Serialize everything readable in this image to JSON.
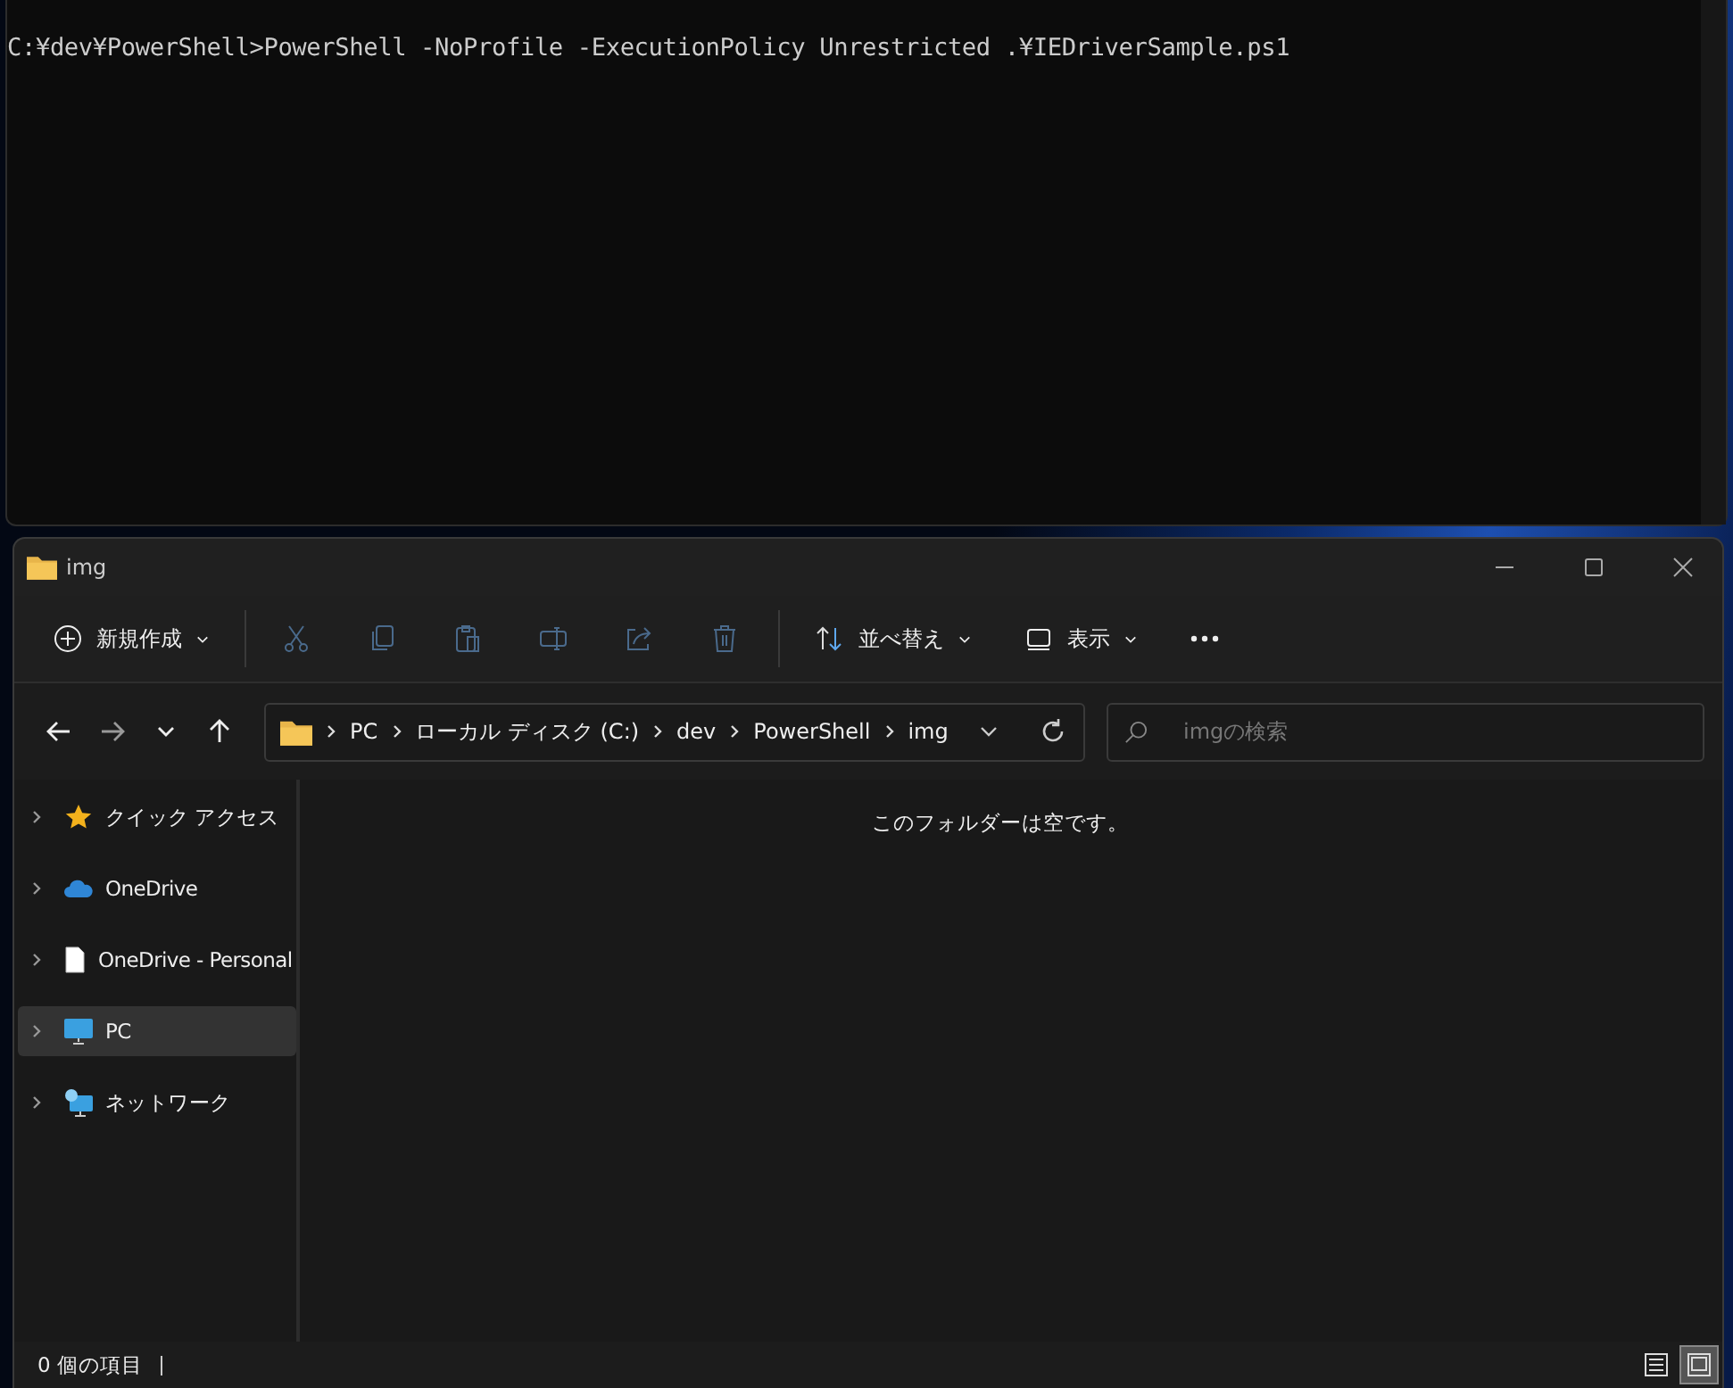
{
  "console": {
    "line": "C:¥dev¥PowerShell>PowerShell -NoProfile -ExecutionPolicy Unrestricted .¥IEDriverSample.ps1"
  },
  "explorer": {
    "title": "img",
    "toolbar": [
      {
        "kind": "new",
        "label": "新規作成",
        "disabled": false
      },
      {
        "kind": "cut",
        "disabled": true
      },
      {
        "kind": "copy",
        "disabled": true
      },
      {
        "kind": "paste",
        "disabled": true
      },
      {
        "kind": "rename",
        "disabled": true
      },
      {
        "kind": "share",
        "disabled": true
      },
      {
        "kind": "delete",
        "disabled": true
      },
      {
        "kind": "sort",
        "label": "並べ替え",
        "disabled": false
      },
      {
        "kind": "view",
        "label": "表示",
        "disabled": false
      },
      {
        "kind": "more",
        "disabled": false
      }
    ],
    "nav": [
      {
        "kind": "back",
        "disabled": false
      },
      {
        "kind": "forward",
        "disabled": true
      },
      {
        "kind": "recent",
        "disabled": false
      },
      {
        "kind": "up",
        "disabled": false
      }
    ],
    "breadcrumb": [
      "PC",
      "ローカル ディスク (C:)",
      "dev",
      "PowerShell",
      "img"
    ],
    "search": {
      "placeholder": "imgの検索"
    },
    "sidebar": [
      {
        "kind": "star",
        "label": "クイック アクセス",
        "selected": false
      },
      {
        "kind": "cloud",
        "label": "OneDrive",
        "selected": false
      },
      {
        "kind": "file",
        "label": "OneDrive - Personal",
        "selected": false
      },
      {
        "kind": "pc",
        "label": "PC",
        "selected": true
      },
      {
        "kind": "network",
        "label": "ネットワーク",
        "selected": false
      }
    ],
    "empty_message": "このフォルダーは空です。",
    "status": "0 個の項目",
    "views": [
      {
        "kind": "details",
        "selected": false
      },
      {
        "kind": "tiles",
        "selected": true
      }
    ]
  }
}
